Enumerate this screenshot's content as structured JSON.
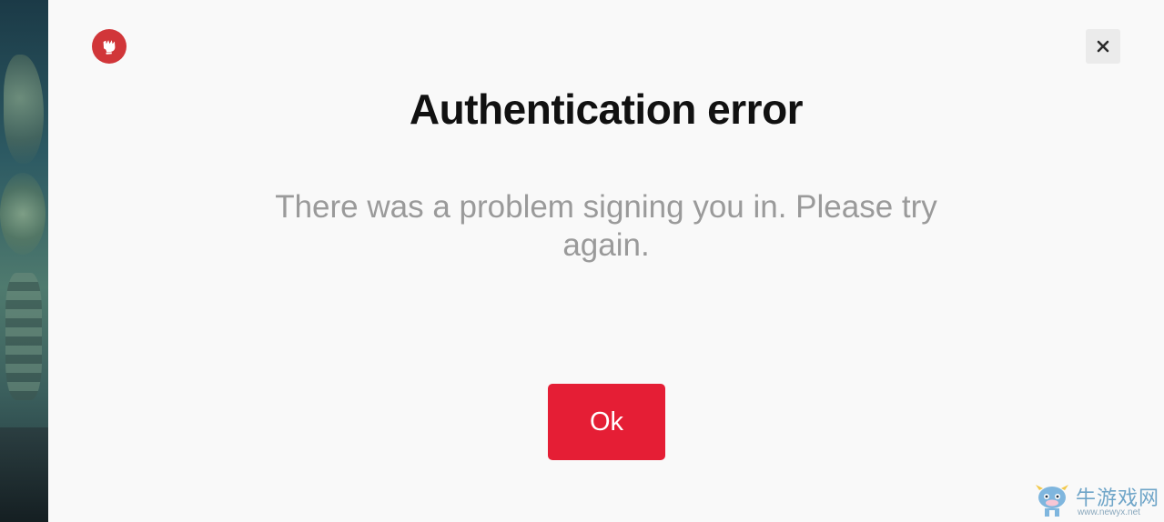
{
  "dialog": {
    "title": "Authentication error",
    "message": "There was a problem signing you in. Please try again.",
    "ok_label": "Ok"
  },
  "icons": {
    "logo": "riot-fist-icon",
    "close": "close-icon"
  },
  "colors": {
    "accent": "#e51e35",
    "logo_bg": "#d13639",
    "background": "#f9f9f9",
    "title_text": "#111111",
    "message_text": "#9a9a9a"
  },
  "watermark": {
    "text": "牛游戏网",
    "url": "www.newyx.net"
  }
}
